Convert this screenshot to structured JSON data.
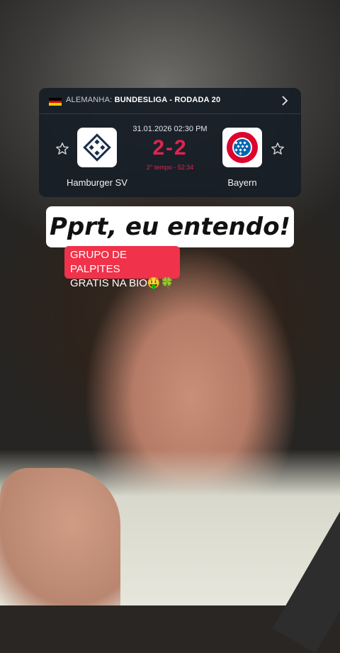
{
  "match": {
    "country_label": "ALEMANHA:",
    "competition": "BUNDESLIGA - RODADA 20",
    "datetime": "31.01.2026 02:30 PM",
    "score": "2-2",
    "period": "2° tempo - 52:34",
    "home_team": "Hamburger SV",
    "away_team": "Bayern",
    "away_logo_text_top": "FC BAYERN",
    "away_logo_text_bottom": "MÜNCHEN"
  },
  "captions": {
    "main": "Pprt, eu entendo!",
    "sub_line1": "GRUPO DE PALPITES",
    "sub_line2": "GRATIS NA BIO🤑🍀"
  },
  "colors": {
    "card_bg": "#161e26",
    "score_red": "#e0244f",
    "caption_red": "#f0324a"
  },
  "icons": [
    "germany-flag-icon",
    "chevron-right-icon",
    "star-outline-icon"
  ]
}
